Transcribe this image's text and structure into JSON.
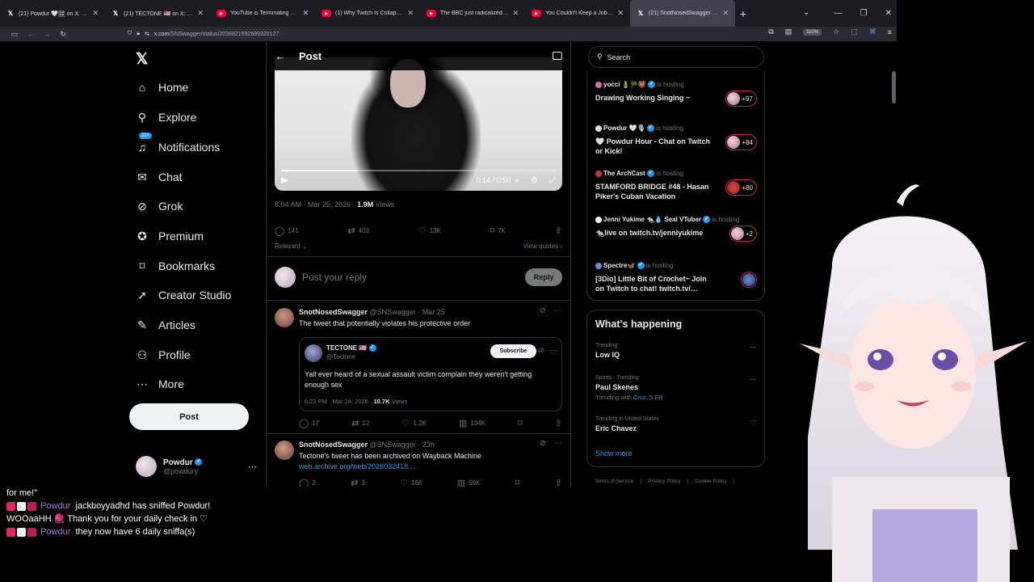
{
  "browser": {
    "tabs": [
      {
        "title": "(21) Powdur 🤍🎛 on X: \"@xan",
        "type": "x"
      },
      {
        "title": "(21) TECTONE 🇺🇸 on X: \"I am do",
        "type": "x"
      },
      {
        "title": "YouTube is Terminating my Cha",
        "type": "yt"
      },
      {
        "title": "(1) Why Twitch Is Collapsing - Y",
        "type": "yt"
      },
      {
        "title": "The BBC just radicalized a gene",
        "type": "yt"
      },
      {
        "title": "You Couldn't Keep a Job If You",
        "type": "yt"
      },
      {
        "title": "(21) SnotNosedSwagger on X: \"",
        "type": "x"
      }
    ],
    "url_host": "x.com",
    "url_path": "/SNSwagger/status/2036821592689320127",
    "zoom": "110%"
  },
  "nav": {
    "items": [
      {
        "label": "Home",
        "icon": "home-icon"
      },
      {
        "label": "Explore",
        "icon": "search-icon"
      },
      {
        "label": "Notifications",
        "icon": "bell-icon"
      },
      {
        "label": "Chat",
        "icon": "mail-icon"
      },
      {
        "label": "Grok",
        "icon": "grok-icon"
      },
      {
        "label": "Premium",
        "icon": "premium-icon"
      },
      {
        "label": "Bookmarks",
        "icon": "bookmark-icon"
      },
      {
        "label": "Creator Studio",
        "icon": "rocket-icon"
      },
      {
        "label": "Articles",
        "icon": "articles-icon"
      },
      {
        "label": "Profile",
        "icon": "person-icon"
      },
      {
        "label": "More",
        "icon": "more-icon"
      }
    ],
    "notif_badge": "20+",
    "post_label": "Post",
    "account": {
      "name": "Powdur",
      "handle": "@powdury"
    }
  },
  "post": {
    "header_title": "Post",
    "video": {
      "time": "0:14 / 0:50",
      "progress": 0.28
    },
    "timestamp": "8:04 AM · Mar 25, 2026 · ",
    "views_count": "1.9M",
    "views_label": " Views",
    "stats": {
      "replies": "141",
      "reposts": "403",
      "likes": "13K",
      "bookmarks": "7K"
    },
    "relevant_label": "Relevant",
    "view_quotes_label": "View quotes",
    "reply_placeholder": "Post your reply",
    "reply_button": "Reply"
  },
  "replies": [
    {
      "name": "SnotNosedSwagger",
      "handle": "@SNSwagger · Mar 25",
      "text": "The tweet that potentially violates his protective order",
      "quote": {
        "name": "TECTONE 🇺🇸",
        "handle": "@Tectone",
        "subscribe": "Subscribe",
        "text": "Yall ever heard of a sexual assault victim complain they weren't getting enough sex",
        "time": "6:23 PM · Mar 24, 2026 · ",
        "views_count": "10.7K",
        "views_label": " Views"
      },
      "stats": {
        "replies": "17",
        "reposts": "12",
        "likes": "1.2K",
        "views": "134K"
      }
    },
    {
      "name": "SnotNosedSwagger",
      "handle": "@SNSwagger · 23h",
      "text": "Tectone's tweet has been archived on Wayback Machine ",
      "link": "web.archive.org/web/2026032418…",
      "stats": {
        "replies": "2",
        "reposts": "3",
        "likes": "168",
        "views": "59K"
      }
    }
  ],
  "sidebar": {
    "search_placeholder": "Search",
    "spaces": [
      {
        "host": "yocci 🎍🎋👹",
        "hosting": "is hosting",
        "title": "Drawing Working Singing ~",
        "count": "+97"
      },
      {
        "host": "Powdur 🤍🎙",
        "hosting": "is hosting",
        "title": "🤍 Powdur Hour - Chat on Twitch or  Kick!",
        "count": "+84"
      },
      {
        "host": "The ArchCast",
        "hosting": "is hosting",
        "title": "STAMFORD BRIDGE #48 - Hasan Piker's Cuban Vacation",
        "count": "+80"
      },
      {
        "host": "Jenni Yukime 🐀💧 Seal VTuber",
        "hosting": "is hosting",
        "title": "🐀live on twitch.tv/jenniyukime",
        "count": "+2"
      },
      {
        "host": "Spectre🦋",
        "hosting": "is hosting",
        "title": "[3Dio] Little Bit of Crochet~ Join on Twitch to chat! twitch.tv/…",
        "count": ""
      }
    ],
    "happening_title": "What's happening",
    "trends": [
      {
        "context": "Trending",
        "name": "Low IQ",
        "with": "",
        "with_link": ""
      },
      {
        "context": "Sports · Trending",
        "name": "Paul Skenes",
        "with": "Trending with ",
        "with_link": "Cruz, 5 ER"
      },
      {
        "context": "Trending in United States",
        "name": "Eric Chavez",
        "with": "",
        "with_link": ""
      }
    ],
    "show_more": "Show more",
    "footer": [
      "Terms of Service",
      "|",
      "Privacy Policy",
      "|",
      "Cookie Policy",
      "|"
    ]
  },
  "chat": {
    "top_fragment": "for me!\"",
    "messages": [
      {
        "user": "Powdur",
        "text": "jackboyyadhd has sniffed Powdur! WOOaaHH 🧶 Thank you for your daily check in ♡"
      },
      {
        "user": "Powdur",
        "text": "they now have 6 daily sniffa(s)"
      }
    ]
  },
  "colors": {
    "accent": "#1d9bf0",
    "chat_user": "#b46ee8",
    "space_ring": "#c91e5f"
  }
}
